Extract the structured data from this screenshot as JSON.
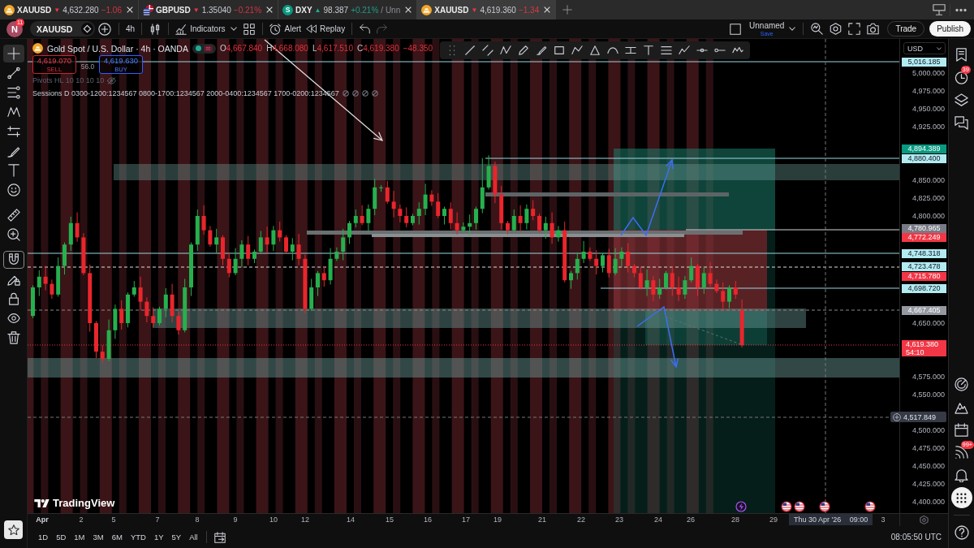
{
  "tabs": [
    {
      "kind": "gold",
      "symbol": "XAUUSD",
      "rising": false,
      "arrow": "▼",
      "price": "4,632.280",
      "change": "−1.06",
      "selected": false
    },
    {
      "kind": "flags",
      "symbol": "GBPUSD",
      "rising": false,
      "arrow": "▼",
      "price": "1.35040",
      "change": "−0.21%",
      "selected": false
    },
    {
      "kind": "letter",
      "logo_text": "S",
      "symbol": "DXY",
      "rising": true,
      "arrow": "▲",
      "price": "98.387",
      "change": "+0.21%",
      "note": "/ Unn",
      "selected": false
    },
    {
      "kind": "gold",
      "symbol": "XAUUSD",
      "rising": false,
      "arrow": "▼",
      "price": "4,619.360",
      "change": "−1.34",
      "selected": true
    }
  ],
  "toolbar": {
    "avatar_letter": "N",
    "avatar_badge": "11",
    "symbol": "XAUUSD",
    "interval": "4h",
    "indicators": "Indicators",
    "alert": "Alert",
    "replay": "Replay",
    "layout_name": "Unnamed",
    "layout_save": "Save",
    "trade": "Trade",
    "publish": "Publish"
  },
  "legend": {
    "title": "Gold Spot / U.S. Dollar · 4h · OANDA",
    "ohlc": [
      {
        "label": "O",
        "value": "4,667.840"
      },
      {
        "label": "H",
        "value": "4,668.080"
      },
      {
        "label": "L",
        "value": "4,617.510"
      },
      {
        "label": "C",
        "value": "4,619.380"
      }
    ],
    "change": "−48.350",
    "sell": {
      "price": "4,619.070",
      "label": "SELL"
    },
    "spread": "56.0",
    "buy": {
      "price": "4,619.630",
      "label": "BUY"
    },
    "indicators": [
      {
        "text": "Pivots HL 10 10 10 10",
        "visible": false
      },
      {
        "text": "Sessions D 0300-1200:1234567 0800-1700:1234567 2000-0400:1234567 1700-0200:1234567",
        "visible": true
      }
    ]
  },
  "left_toolbar": {
    "tools": [
      {
        "selected": true
      },
      {
        "selected": false
      },
      {
        "selected": false
      },
      {
        "selected": false
      },
      {
        "selected": false
      },
      {
        "selected": false
      },
      {
        "selected": false
      },
      {
        "selected": false
      },
      {
        "selected": false
      },
      {
        "selected": false
      }
    ],
    "magnet_on": true
  },
  "chart": {
    "logo_text": "TradingView"
  },
  "price_axis": {
    "currency": "USD",
    "ticks": [
      "5,000.000",
      "4,975.000",
      "4,950.000",
      "4,925.000",
      "4,850.000",
      "4,825.000",
      "4,800.000",
      "4,650.000",
      "4,575.000",
      "4,550.000",
      "4,500.000",
      "4,475.000",
      "4,450.000",
      "4,425.000",
      "4,400.000"
    ],
    "tags": [
      {
        "kind": "line",
        "color": "#b2ebf2",
        "text": "5,016.185"
      },
      {
        "kind": "solid",
        "color": "#089981",
        "text": "4,894.389"
      },
      {
        "kind": "line",
        "color": "#b2ebf2",
        "text": "4,880.400"
      },
      {
        "kind": "solid",
        "color": "#787b86",
        "text": "4,780.965"
      },
      {
        "kind": "solid",
        "color": "#f23645",
        "text": "4,772.249"
      },
      {
        "kind": "line",
        "color": "#b2ebf2",
        "text": "4,748.318"
      },
      {
        "kind": "line",
        "color": "#b2ebf2",
        "text": "4,723.478"
      },
      {
        "kind": "solid",
        "color": "#f23645",
        "text": "4,715.780"
      },
      {
        "kind": "line",
        "color": "#b2ebf2",
        "text": "4,698.720"
      },
      {
        "kind": "solid",
        "color": "#9598a1",
        "text": "4,667.405"
      },
      {
        "kind": "last",
        "color": "#f23645",
        "text": "4,619.380",
        "countdown": "54:10"
      },
      {
        "kind": "crosshair",
        "text": "4,517.849"
      }
    ]
  },
  "time_axis": {
    "labels": [
      {
        "kind": "month",
        "text": "Apr"
      },
      {
        "kind": "day",
        "text": "2"
      },
      {
        "kind": "day",
        "text": "5"
      },
      {
        "kind": "day",
        "text": "7"
      },
      {
        "kind": "day",
        "text": "8"
      },
      {
        "kind": "day",
        "text": "9"
      },
      {
        "kind": "day",
        "text": "10"
      },
      {
        "kind": "day",
        "text": "12"
      },
      {
        "kind": "day",
        "text": "14"
      },
      {
        "kind": "day",
        "text": "15"
      },
      {
        "kind": "day",
        "text": "16"
      },
      {
        "kind": "day",
        "text": "17"
      },
      {
        "kind": "day",
        "text": "19"
      },
      {
        "kind": "day",
        "text": "21"
      },
      {
        "kind": "day",
        "text": "22"
      },
      {
        "kind": "day",
        "text": "23"
      },
      {
        "kind": "day",
        "text": "24"
      },
      {
        "kind": "day",
        "text": "26"
      },
      {
        "kind": "day",
        "text": "28"
      },
      {
        "kind": "day",
        "text": "29"
      },
      {
        "kind": "day",
        "text": "3"
      }
    ],
    "crosshair": {
      "date": "Thu 30 Apr '26",
      "time": "09:00"
    }
  },
  "bottom_bar": {
    "ranges": [
      "1D",
      "5D",
      "1M",
      "3M",
      "6M",
      "YTD",
      "1Y",
      "5Y",
      "All"
    ],
    "clock": "08:05:50 UTC"
  },
  "right_sidebar": {
    "items": [
      {
        "selected": false
      },
      {
        "selected": false,
        "badge": "39"
      },
      {
        "selected": false
      },
      {
        "selected": false
      },
      {
        "selected": false
      },
      {
        "selected": false
      },
      {
        "selected": false
      },
      {
        "selected": false,
        "badge": "99+"
      },
      {
        "selected": false
      },
      {
        "selected": true
      }
    ]
  }
}
